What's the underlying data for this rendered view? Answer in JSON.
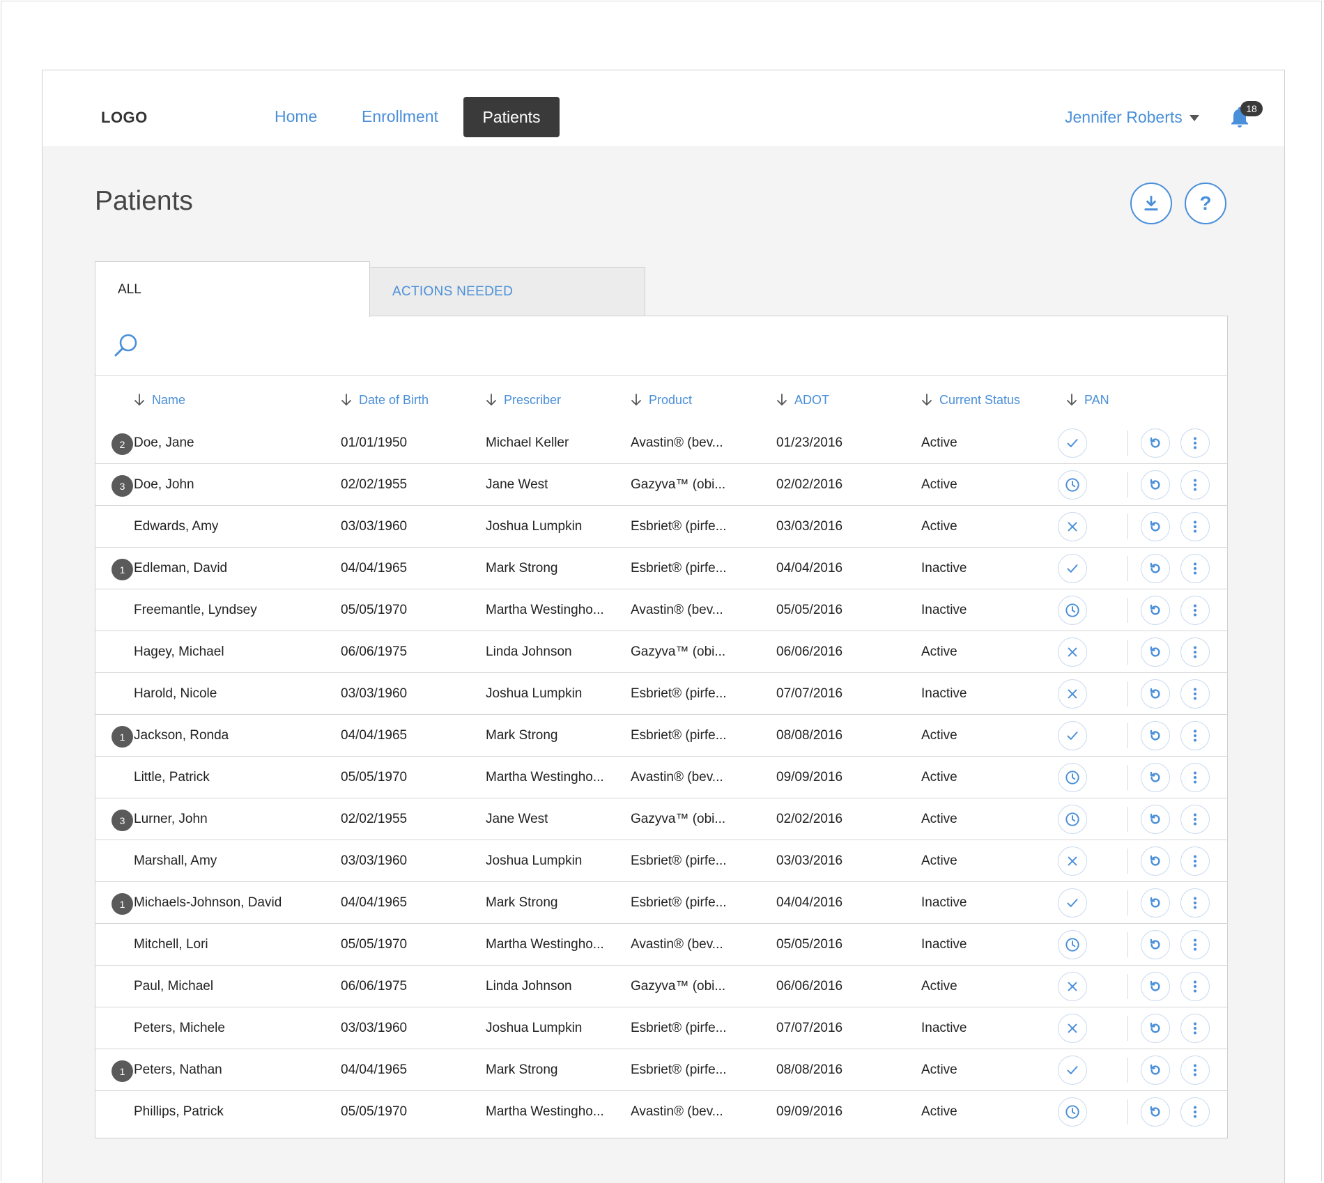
{
  "nav": {
    "logo": "LOGO",
    "links": [
      "Home",
      "Enrollment",
      "Patients"
    ],
    "active": "Patients",
    "user_name": "Jennifer Roberts",
    "notifications_count": "18"
  },
  "page": {
    "title": "Patients",
    "download_icon": "download-icon",
    "help_label": "?"
  },
  "tabs": [
    "ALL",
    "ACTIONS NEEDED"
  ],
  "colors": {
    "accent": "#4a8fd9",
    "dark": "#3a3a3a",
    "badge": "#5a5a5a"
  },
  "table": {
    "columns": [
      "Name",
      "Date of Birth",
      "Prescriber",
      "Product",
      "ADOT",
      "Current Status",
      "PAN"
    ],
    "rows": [
      {
        "badge": "2",
        "name": "Doe, Jane",
        "dob": "01/01/1950",
        "prescriber": "Michael Keller",
        "product": "Avastin® (bev...",
        "adot": "01/23/2016",
        "status": "Active",
        "pan": "check"
      },
      {
        "badge": "3",
        "name": "Doe, John",
        "dob": "02/02/1955",
        "prescriber": "Jane West",
        "product": "Gazyva™ (obi...",
        "adot": "02/02/2016",
        "status": "Active",
        "pan": "clock"
      },
      {
        "badge": "",
        "name": "Edwards, Amy",
        "dob": "03/03/1960",
        "prescriber": "Joshua Lumpkin",
        "product": "Esbriet® (pirfe...",
        "adot": "03/03/2016",
        "status": "Active",
        "pan": "x"
      },
      {
        "badge": "1",
        "name": "Edleman, David",
        "dob": "04/04/1965",
        "prescriber": "Mark Strong",
        "product": "Esbriet® (pirfe...",
        "adot": "04/04/2016",
        "status": "Inactive",
        "pan": "check"
      },
      {
        "badge": "",
        "name": "Freemantle, Lyndsey",
        "dob": "05/05/1970",
        "prescriber": "Martha Westingho...",
        "product": "Avastin® (bev...",
        "adot": "05/05/2016",
        "status": "Inactive",
        "pan": "clock"
      },
      {
        "badge": "",
        "name": "Hagey, Michael",
        "dob": "06/06/1975",
        "prescriber": "Linda Johnson",
        "product": "Gazyva™ (obi...",
        "adot": "06/06/2016",
        "status": "Active",
        "pan": "x"
      },
      {
        "badge": "",
        "name": "Harold, Nicole",
        "dob": "03/03/1960",
        "prescriber": "Joshua Lumpkin",
        "product": "Esbriet® (pirfe...",
        "adot": "07/07/2016",
        "status": "Inactive",
        "pan": "x"
      },
      {
        "badge": "1",
        "name": "Jackson, Ronda",
        "dob": "04/04/1965",
        "prescriber": "Mark Strong",
        "product": "Esbriet® (pirfe...",
        "adot": "08/08/2016",
        "status": "Active",
        "pan": "check"
      },
      {
        "badge": "",
        "name": "Little, Patrick",
        "dob": "05/05/1970",
        "prescriber": "Martha Westingho...",
        "product": "Avastin® (bev...",
        "adot": "09/09/2016",
        "status": "Active",
        "pan": "clock"
      },
      {
        "badge": "3",
        "name": "Lurner, John",
        "dob": "02/02/1955",
        "prescriber": "Jane West",
        "product": "Gazyva™ (obi...",
        "adot": "02/02/2016",
        "status": "Active",
        "pan": "clock"
      },
      {
        "badge": "",
        "name": "Marshall, Amy",
        "dob": "03/03/1960",
        "prescriber": "Joshua Lumpkin",
        "product": "Esbriet® (pirfe...",
        "adot": "03/03/2016",
        "status": "Active",
        "pan": "x"
      },
      {
        "badge": "1",
        "name": "Michaels-Johnson, David",
        "dob": "04/04/1965",
        "prescriber": "Mark Strong",
        "product": "Esbriet® (pirfe...",
        "adot": "04/04/2016",
        "status": "Inactive",
        "pan": "check"
      },
      {
        "badge": "",
        "name": "Mitchell, Lori",
        "dob": "05/05/1970",
        "prescriber": "Martha Westingho...",
        "product": "Avastin® (bev...",
        "adot": "05/05/2016",
        "status": "Inactive",
        "pan": "clock"
      },
      {
        "badge": "",
        "name": "Paul, Michael",
        "dob": "06/06/1975",
        "prescriber": "Linda Johnson",
        "product": "Gazyva™ (obi...",
        "adot": "06/06/2016",
        "status": "Active",
        "pan": "x"
      },
      {
        "badge": "",
        "name": "Peters, Michele",
        "dob": "03/03/1960",
        "prescriber": "Joshua Lumpkin",
        "product": "Esbriet® (pirfe...",
        "adot": "07/07/2016",
        "status": "Inactive",
        "pan": "x"
      },
      {
        "badge": "1",
        "name": "Peters, Nathan",
        "dob": "04/04/1965",
        "prescriber": "Mark Strong",
        "product": "Esbriet® (pirfe...",
        "adot": "08/08/2016",
        "status": "Active",
        "pan": "check"
      },
      {
        "badge": "",
        "name": "Phillips, Patrick",
        "dob": "05/05/1970",
        "prescriber": "Martha Westingho...",
        "product": "Avastin® (bev...",
        "adot": "09/09/2016",
        "status": "Active",
        "pan": "clock"
      }
    ]
  }
}
